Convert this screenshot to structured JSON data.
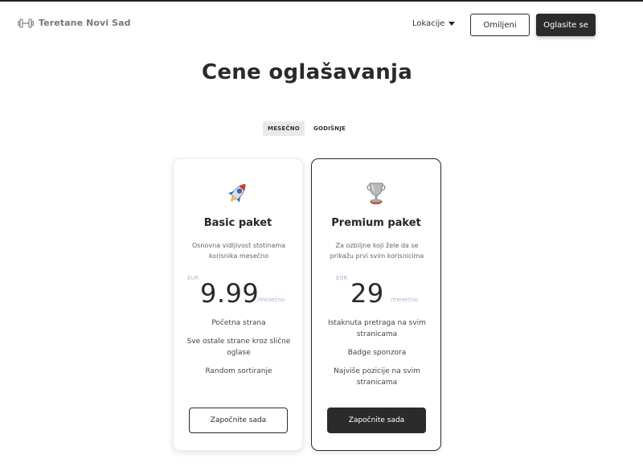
{
  "header": {
    "brand_name": "Teretane Novi Sad",
    "brand_icon": "dumbbell-icon",
    "nav_locations": "Lokacije",
    "favorites_label": "Omiljeni",
    "advertise_label": "Oglasite se"
  },
  "page_title": "Cene oglašavanja",
  "billing_toggle": {
    "monthly": "MESEČNO",
    "yearly": "GODIŠNJE",
    "selected": "MESEČNO"
  },
  "plans": [
    {
      "name": "Basic paket",
      "icon": "rocket-icon",
      "description": "Osnovna vidljivost stotinama korisnika mesečno",
      "currency": "EUR",
      "price": "9.99",
      "period": "/mesečno",
      "features": [
        "Početna strana",
        "Sve ostale strane kroz slične oglase",
        "Random sortiranje"
      ],
      "cta": "Započnite sada"
    },
    {
      "name": "Premium paket",
      "icon": "trophy-icon",
      "description": "Za ozbiljne koji žele da se prikažu prvi svim korisnicima",
      "currency": "EUR",
      "price": "29",
      "period": "/mesečno",
      "features": [
        "Istaknuta pretraga na svim stranicama",
        "Badge sponzora",
        "Najviše pozicije na svim stranicama"
      ],
      "cta": "Započnite sada"
    }
  ],
  "colors": {
    "primary_dark": "#2b2b2b",
    "price_meta": "#a9b8d3",
    "toggle_active_bg": "#e9e9e9"
  }
}
